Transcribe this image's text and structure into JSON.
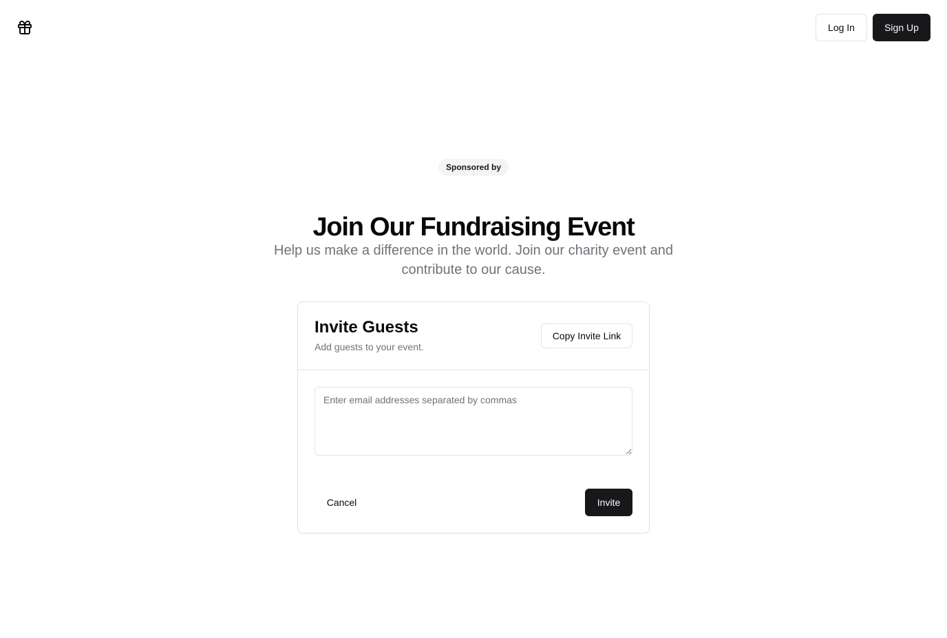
{
  "header": {
    "logo_icon": "gift-icon",
    "login_label": "Log In",
    "signup_label": "Sign Up"
  },
  "hero": {
    "badge": "Sponsored by",
    "title": "Join Our Fundraising Event",
    "subtitle": "Help us make a difference in the world. Join our charity event and contribute to our cause."
  },
  "invite_card": {
    "title": "Invite Guests",
    "description": "Add guests to your event.",
    "copy_link_label": "Copy Invite Link",
    "emails_placeholder": "Enter email addresses separated by commas",
    "emails_value": "",
    "cancel_label": "Cancel",
    "invite_label": "Invite"
  },
  "colors": {
    "primary": "#18181b",
    "muted_text": "#71717a",
    "border": "#e4e4e7",
    "badge_bg": "#f4f4f5"
  }
}
